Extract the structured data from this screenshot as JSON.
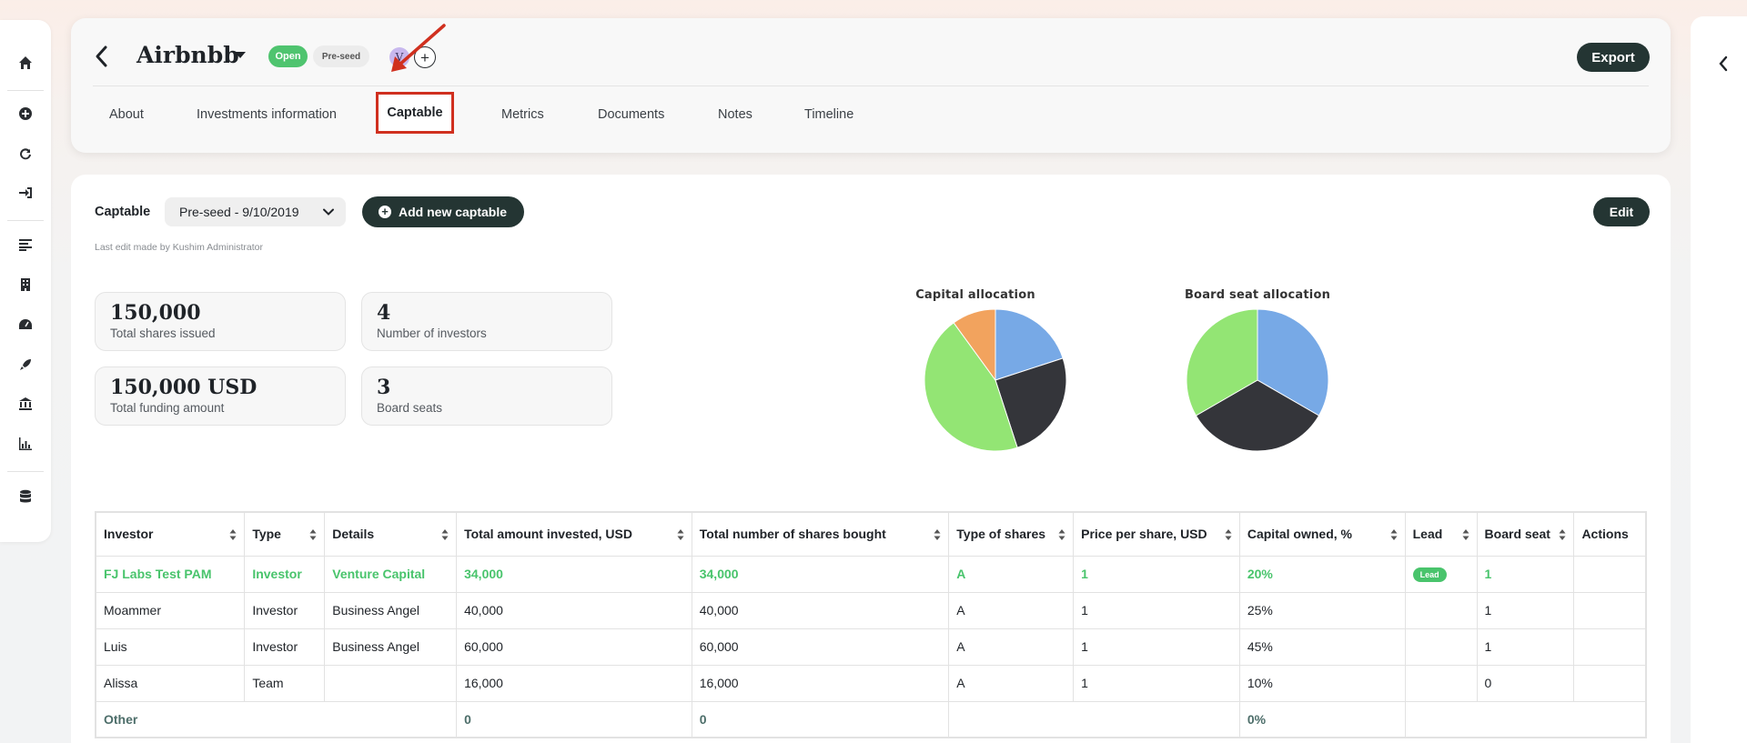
{
  "company": {
    "name": "Airbnbb",
    "status_badge": "Open",
    "stage_badge": "Pre-seed",
    "member_initial": "V"
  },
  "header": {
    "export_label": "Export"
  },
  "tabs": [
    {
      "label": "About"
    },
    {
      "label": "Investments information"
    },
    {
      "label": "Captable",
      "active": true
    },
    {
      "label": "Metrics"
    },
    {
      "label": "Documents"
    },
    {
      "label": "Notes"
    },
    {
      "label": "Timeline"
    }
  ],
  "captable": {
    "label": "Captable",
    "selected": "Pre-seed - 9/10/2019",
    "add_label": "Add new captable",
    "edit_label": "Edit",
    "last_edit": "Last edit made by Kushim Administrator"
  },
  "stats": [
    {
      "value": "150,000",
      "label": "Total shares issued"
    },
    {
      "value": "4",
      "label": "Number of investors"
    },
    {
      "value": "150,000 USD",
      "label": "Total funding amount"
    },
    {
      "value": "3",
      "label": "Board seats"
    }
  ],
  "chart_data": [
    {
      "type": "pie",
      "title": "Capital allocation",
      "categories": [
        "FJ Labs Test PAM",
        "Moammer",
        "Luis",
        "Alissa"
      ],
      "values": [
        20,
        25,
        45,
        10
      ],
      "colors": [
        "#77a9e6",
        "#34353a",
        "#93e574",
        "#f2a35e"
      ]
    },
    {
      "type": "pie",
      "title": "Board seat allocation",
      "categories": [
        "FJ Labs Test PAM",
        "Moammer",
        "Luis"
      ],
      "values": [
        1,
        1,
        1
      ],
      "colors": [
        "#77a9e6",
        "#34353a",
        "#93e574"
      ]
    }
  ],
  "table": {
    "columns": [
      "Investor",
      "Type",
      "Details",
      "Total amount invested, USD",
      "Total number of shares bought",
      "Type of shares",
      "Price per share, USD",
      "Capital owned, %",
      "Lead",
      "Board seat",
      "Actions"
    ],
    "rows": [
      {
        "investor": "FJ Labs Test PAM",
        "type": "Investor",
        "details": "Venture Capital",
        "amount": "34,000",
        "shares": "34,000",
        "share_type": "A",
        "price": "1",
        "capital": "20%",
        "lead": "Lead",
        "board": "1"
      },
      {
        "investor": "Moammer",
        "type": "Investor",
        "details": "Business Angel",
        "amount": "40,000",
        "shares": "40,000",
        "share_type": "A",
        "price": "1",
        "capital": "25%",
        "lead": "",
        "board": "1"
      },
      {
        "investor": "Luis",
        "type": "Investor",
        "details": "Business Angel",
        "amount": "60,000",
        "shares": "60,000",
        "share_type": "A",
        "price": "1",
        "capital": "45%",
        "lead": "",
        "board": "1"
      },
      {
        "investor": "Alissa",
        "type": "Team",
        "details": "",
        "amount": "16,000",
        "shares": "16,000",
        "share_type": "A",
        "price": "1",
        "capital": "10%",
        "lead": "",
        "board": "0"
      }
    ],
    "other": {
      "label": "Other",
      "amount": "0",
      "shares": "0",
      "capital": "0%"
    }
  },
  "colors": {
    "accent_dark": "#243533",
    "green": "#49c46c",
    "highlight_red": "#d0301f"
  }
}
